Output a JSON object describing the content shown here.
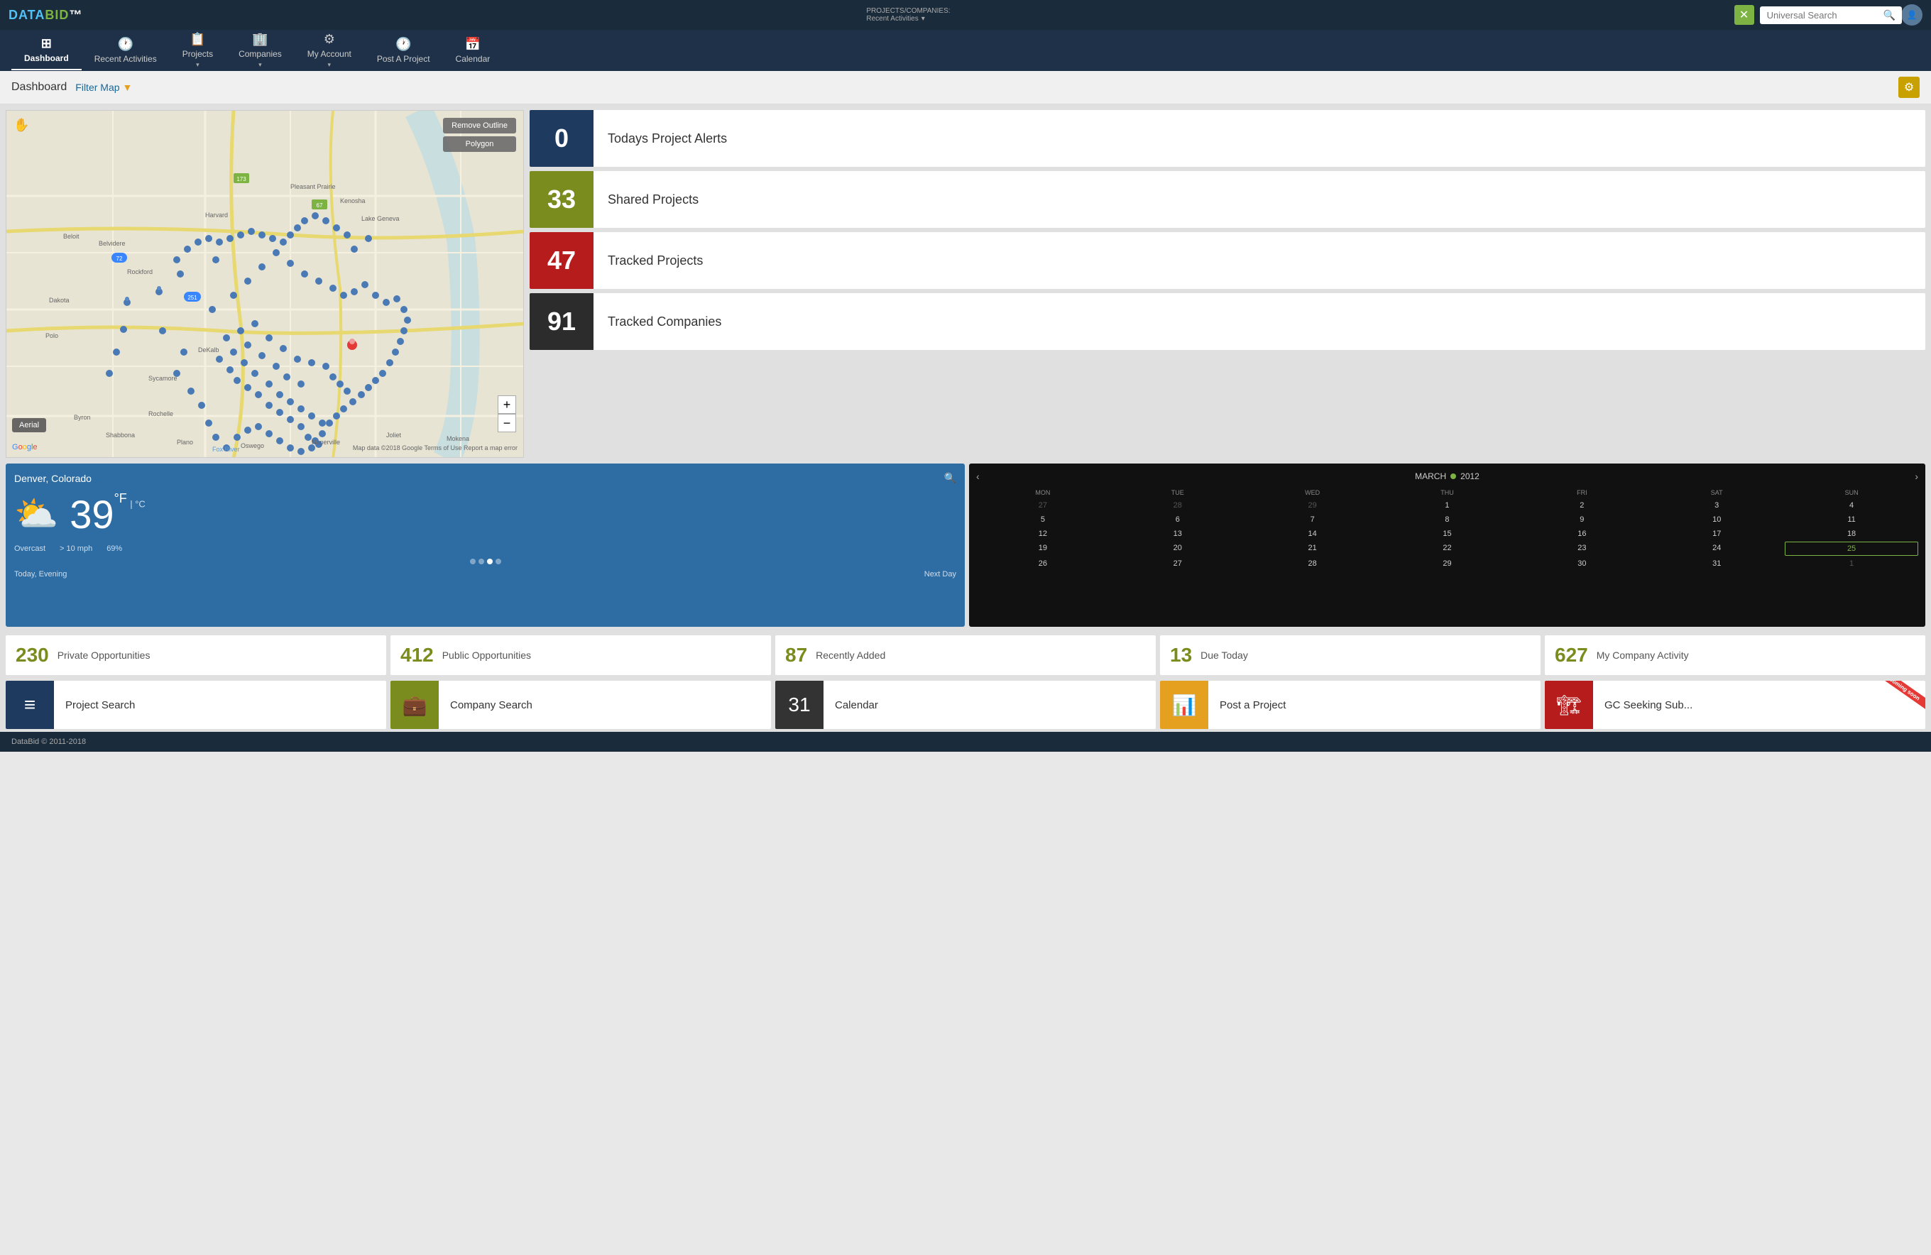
{
  "topbar": {
    "logo": "DATABID",
    "breadcrumb_label": "PROJECTS/COMPANIES:",
    "breadcrumb_value": "Recent Activities",
    "search_placeholder": "Universal Search"
  },
  "nav": {
    "items": [
      {
        "id": "dashboard",
        "icon": "⊞",
        "label": "Dashboard",
        "active": true
      },
      {
        "id": "recent-activities",
        "icon": "🕐",
        "label": "Recent Activities",
        "active": false
      },
      {
        "id": "projects",
        "icon": "📋",
        "label": "Projects",
        "active": false
      },
      {
        "id": "companies",
        "icon": "🏢",
        "label": "Companies",
        "active": false
      },
      {
        "id": "my-account",
        "icon": "⚙",
        "label": "My Account",
        "active": false
      },
      {
        "id": "post-a-project",
        "icon": "🕐",
        "label": "Post A Project",
        "active": false
      },
      {
        "id": "calendar",
        "icon": "📅",
        "label": "Calendar",
        "active": false
      }
    ]
  },
  "dashboard_header": {
    "title": "Dashboard",
    "filter_map_label": "Filter Map",
    "remove_outline_btn": "Remove Outline",
    "polygon_btn": "Polygon",
    "aerial_btn": "Aerial"
  },
  "stats": [
    {
      "id": "today-alerts",
      "value": "0",
      "label": "Todays Project Alerts",
      "color": "#1e3a5f"
    },
    {
      "id": "shared-projects",
      "value": "33",
      "label": "Shared Projects",
      "color": "#7b8c1e"
    },
    {
      "id": "tracked-projects",
      "value": "47",
      "label": "Tracked Projects",
      "color": "#b71c1c"
    },
    {
      "id": "tracked-companies",
      "value": "91",
      "label": "Tracked Companies",
      "color": "#2c2c2c"
    }
  ],
  "weather": {
    "city": "Denver, Colorado",
    "temp": "39",
    "unit": "°F",
    "unit_alt": "| °C",
    "condition": "Overcast",
    "wind": "> 10 mph",
    "humidity": "69%",
    "period_today": "Today, Evening",
    "period_next": "Next Day"
  },
  "calendar": {
    "month": "MARCH",
    "year": "2012",
    "day_labels": [
      "MON",
      "TUE",
      "WED",
      "THU",
      "FRI",
      "SAT",
      "SUN"
    ],
    "weeks": [
      [
        "27",
        "28",
        "29",
        "1",
        "2",
        "3",
        "4"
      ],
      [
        "5",
        "6",
        "7",
        "8",
        "9",
        "10",
        "11"
      ],
      [
        "12",
        "13",
        "14",
        "15",
        "16",
        "17",
        "18"
      ],
      [
        "19",
        "20",
        "21",
        "22",
        "23",
        "24",
        "25"
      ],
      [
        "26",
        "27",
        "28",
        "29",
        "30",
        "31",
        "1"
      ]
    ],
    "today": "25",
    "other_month_days": [
      "27",
      "28",
      "29",
      "1"
    ]
  },
  "bottom_stats": [
    {
      "id": "private-opps",
      "value": "230",
      "label": "Private Opportunities",
      "color": "#7b8c1e"
    },
    {
      "id": "public-opps",
      "value": "412",
      "label": "Public Opportunities",
      "color": "#7b8c1e"
    },
    {
      "id": "recently-added",
      "value": "87",
      "label": "Recently Added",
      "color": "#7b8c1e"
    },
    {
      "id": "due-today",
      "value": "13",
      "label": "Due Today",
      "color": "#7b8c1e"
    },
    {
      "id": "company-activity",
      "value": "627",
      "label": "My Company Activity",
      "color": "#7b8c1e"
    }
  ],
  "quick_access": [
    {
      "id": "project-search",
      "icon": "≡",
      "label": "Project Search",
      "bg": "#1e3a5f"
    },
    {
      "id": "company-search",
      "icon": "💼",
      "label": "Company Search",
      "bg": "#7b8c1e"
    },
    {
      "id": "calendar-qa",
      "icon": "31",
      "label": "Calendar",
      "bg": "#333"
    },
    {
      "id": "post-project",
      "icon": "📊",
      "label": "Post a Project",
      "bg": "#e6a020"
    },
    {
      "id": "gc-seeking",
      "icon": "🏗",
      "label": "GC Seeking Sub...",
      "bg": "#b71c1c",
      "coming_soon": true
    }
  ],
  "footer": {
    "text": "DataBid © 2011-2018"
  },
  "map": {
    "attribution": "Map data ©2018 Google  Terms of Use  Report a map error"
  }
}
